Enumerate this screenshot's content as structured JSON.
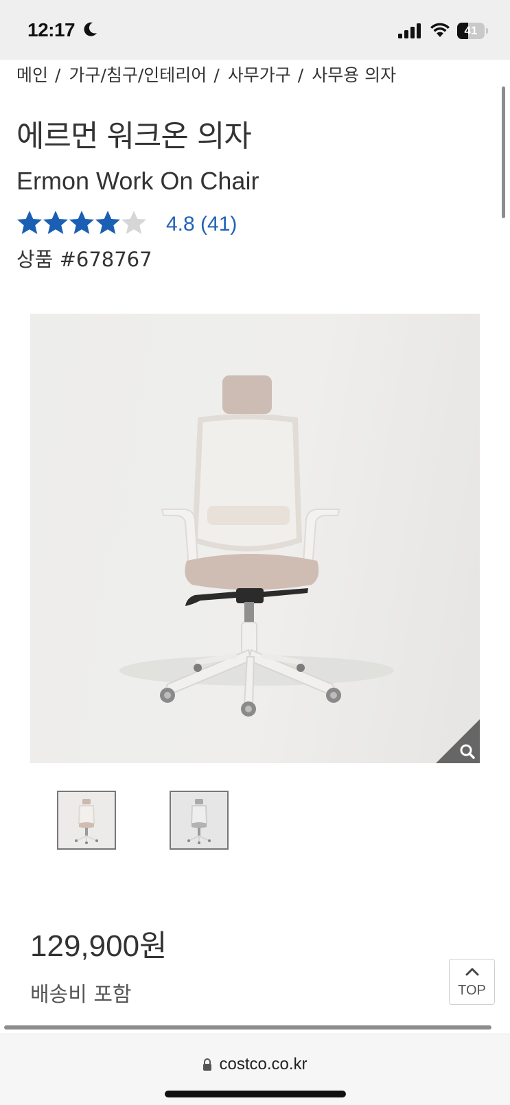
{
  "status_bar": {
    "time": "12:17",
    "battery_level": "41",
    "icons": [
      "moon-icon",
      "cellular-signal-icon",
      "wifi-icon",
      "battery-icon"
    ]
  },
  "breadcrumb": {
    "items": [
      "메인",
      "가구/침구/인테리어",
      "사무가구",
      "사무용 의자"
    ],
    "separator": "/"
  },
  "product": {
    "title_ko": "에르먼 워크온 의자",
    "title_en": "Ermon Work On Chair",
    "rating_value": 4.8,
    "rating_text": "4.8 (41)",
    "star_count": 5,
    "item_number": "상품 #678767",
    "price": "129,900원",
    "shipping": "배송비 포함",
    "colors": {
      "star": "#1a5fb4",
      "rating_text": "#1f62b7"
    }
  },
  "gallery": {
    "main_image": "office-chair-beige",
    "thumbnails": [
      "office-chair-beige",
      "office-chair-gray"
    ],
    "zoom_icon": "magnifier-icon"
  },
  "top_button": {
    "label": "TOP",
    "icon": "chevron-up-icon"
  },
  "browser": {
    "url": "costco.co.kr",
    "icon": "lock-icon"
  }
}
